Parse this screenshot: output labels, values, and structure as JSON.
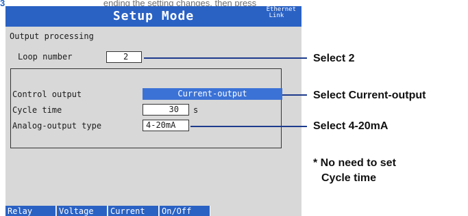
{
  "caption_fragment": {
    "highlight": "3",
    "text": "ending  the  setting  changes,  then press"
  },
  "window": {
    "title": "Setup Mode",
    "status_line1": "Ethernet",
    "status_line2": "Link"
  },
  "screen": {
    "heading": "Output processing",
    "loop_number_label": "Loop number",
    "loop_number_value": "2",
    "control_output_label": "Control output",
    "control_output_value": "Current-output",
    "cycle_time_label": "Cycle time",
    "cycle_time_value": "30",
    "cycle_time_unit": "s",
    "analog_output_label": "Analog-output type",
    "analog_output_value": "4-20mA"
  },
  "softkeys": [
    "Relay",
    "Voltage",
    "Current",
    "On/Off"
  ],
  "callouts": {
    "loop": "Select 2",
    "control": "Select Current-output",
    "analog": "Select 4-20mA",
    "note_line1": "* No need to set",
    "note_line2": "Cycle time"
  },
  "colors": {
    "titlebar": "#2a62c4",
    "selected_field": "#3b72d6",
    "screen_bg": "#d8d8d8",
    "callout_line": "#1c3a8c"
  }
}
